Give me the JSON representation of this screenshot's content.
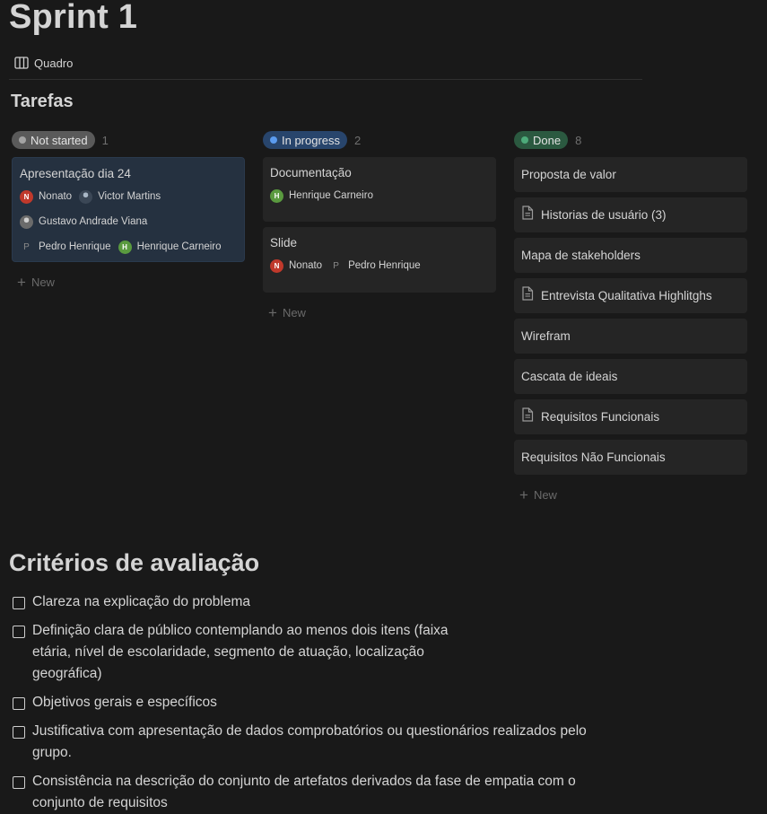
{
  "page": {
    "title": "Sprint 1"
  },
  "view": {
    "label": "Quadro",
    "icon": "board-icon"
  },
  "database": {
    "title": "Tarefas"
  },
  "columns": [
    {
      "status": "Not started",
      "count": "1",
      "color": "#5a5a5a",
      "dot": "#a3a3a3",
      "new_label": "New",
      "cards": [
        {
          "title": "Apresentação dia 24",
          "people": [
            "Nonato",
            "Victor Martins",
            "Gustavo Andrade Viana",
            "Pedro Henrique",
            "Henrique Carneiro"
          ]
        }
      ]
    },
    {
      "status": "In progress",
      "count": "2",
      "color": "#28456c",
      "dot": "#5b9cf0",
      "new_label": "New",
      "cards": [
        {
          "title": "Documentação",
          "people": [
            "Henrique Carneiro"
          ]
        },
        {
          "title": "Slide",
          "people": [
            "Nonato",
            "Pedro Henrique"
          ]
        }
      ]
    },
    {
      "status": "Done",
      "count": "8",
      "color": "#2b5940",
      "dot": "#4dab7a",
      "new_label": "New",
      "cards": [
        {
          "title": "Proposta de valor",
          "doc_icon": false
        },
        {
          "title": "Historias de usuário (3)",
          "doc_icon": true
        },
        {
          "title": "Mapa de stakeholders",
          "doc_icon": false
        },
        {
          "title": "Entrevista Qualitativa Highlitghs",
          "doc_icon": true
        },
        {
          "title": "Wirefram",
          "doc_icon": false
        },
        {
          "title": "Cascata de ideais",
          "doc_icon": false
        },
        {
          "title": "Requisitos Funcionais",
          "doc_icon": true
        },
        {
          "title": "Requisitos Não Funcionais",
          "doc_icon": false
        }
      ]
    }
  ],
  "avatars": {
    "Nonato": "N",
    "Henrique Carneiro": "H",
    "Pedro Henrique": "P"
  },
  "criteria": {
    "heading": "Critérios de avaliação",
    "items": [
      "Clareza na explicação do problema",
      "Definição clara de público contemplando ao menos dois itens (faixa etária, nível de escolaridade, segmento de atuação, localização geográfica)",
      "Objetivos gerais e específicos",
      "Justificativa com apresentação de dados comprobatórios ou questionários realizados pelo grupo.",
      "Consistência na descrição do conjunto de artefatos derivados da fase de empatia com o conjunto de requisitos"
    ]
  }
}
